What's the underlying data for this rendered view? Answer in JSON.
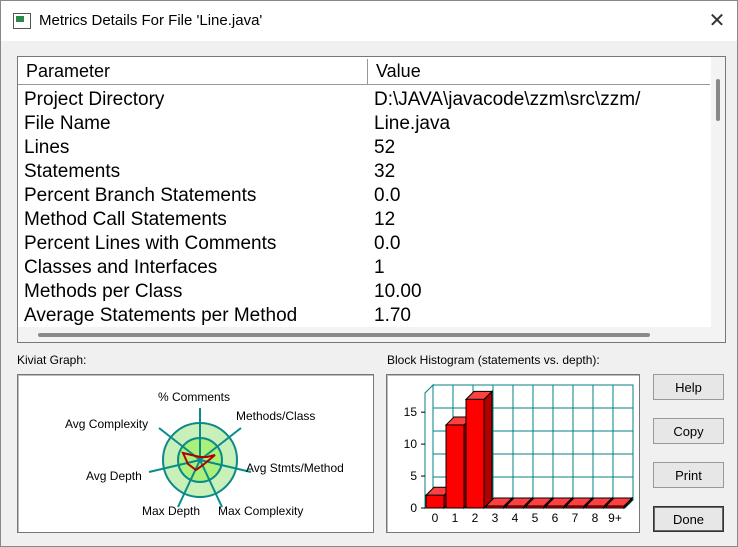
{
  "window": {
    "title": "Metrics Details For File 'Line.java'",
    "close_glyph": "✕"
  },
  "table": {
    "headers": {
      "parameter": "Parameter",
      "value": "Value"
    },
    "rows": [
      {
        "parameter": "Project Directory",
        "value": "D:\\JAVA\\javacode\\zzm\\src\\zzm/"
      },
      {
        "parameter": "File Name",
        "value": "Line.java"
      },
      {
        "parameter": "Lines",
        "value": "52"
      },
      {
        "parameter": "Statements",
        "value": "32"
      },
      {
        "parameter": "Percent Branch Statements",
        "value": "0.0"
      },
      {
        "parameter": "Method Call Statements",
        "value": "12"
      },
      {
        "parameter": "Percent Lines with Comments",
        "value": "0.0"
      },
      {
        "parameter": "Classes and Interfaces",
        "value": "1"
      },
      {
        "parameter": "Methods per Class",
        "value": "10.00"
      },
      {
        "parameter": "Average Statements per Method",
        "value": "1.70"
      }
    ]
  },
  "kiviat": {
    "label": "Kiviat Graph:",
    "axes": {
      "comments": "% Comments",
      "methods_class": "Methods/Class",
      "avg_stmts": "Avg Stmts/Method",
      "max_complexity": "Max Complexity",
      "max_depth": "Max Depth",
      "avg_depth": "Avg Depth",
      "avg_complexity": "Avg Complexity"
    }
  },
  "histogram": {
    "label": "Block Histogram (statements vs. depth):",
    "y_ticks": [
      "0",
      "5",
      "10",
      "15"
    ]
  },
  "buttons": {
    "help": "Help",
    "copy": "Copy",
    "print": "Print",
    "done": "Done"
  },
  "chart_data": {
    "type": "bar",
    "categories": [
      "0",
      "1",
      "2",
      "3",
      "4",
      "5",
      "6",
      "7",
      "8",
      "9+"
    ],
    "values": [
      2,
      13,
      17,
      0,
      0,
      0,
      0,
      0,
      0,
      0
    ],
    "ylim": [
      0,
      18
    ],
    "grid": true,
    "colors": {
      "bar": "#ff0000",
      "grid": "#008080"
    }
  }
}
